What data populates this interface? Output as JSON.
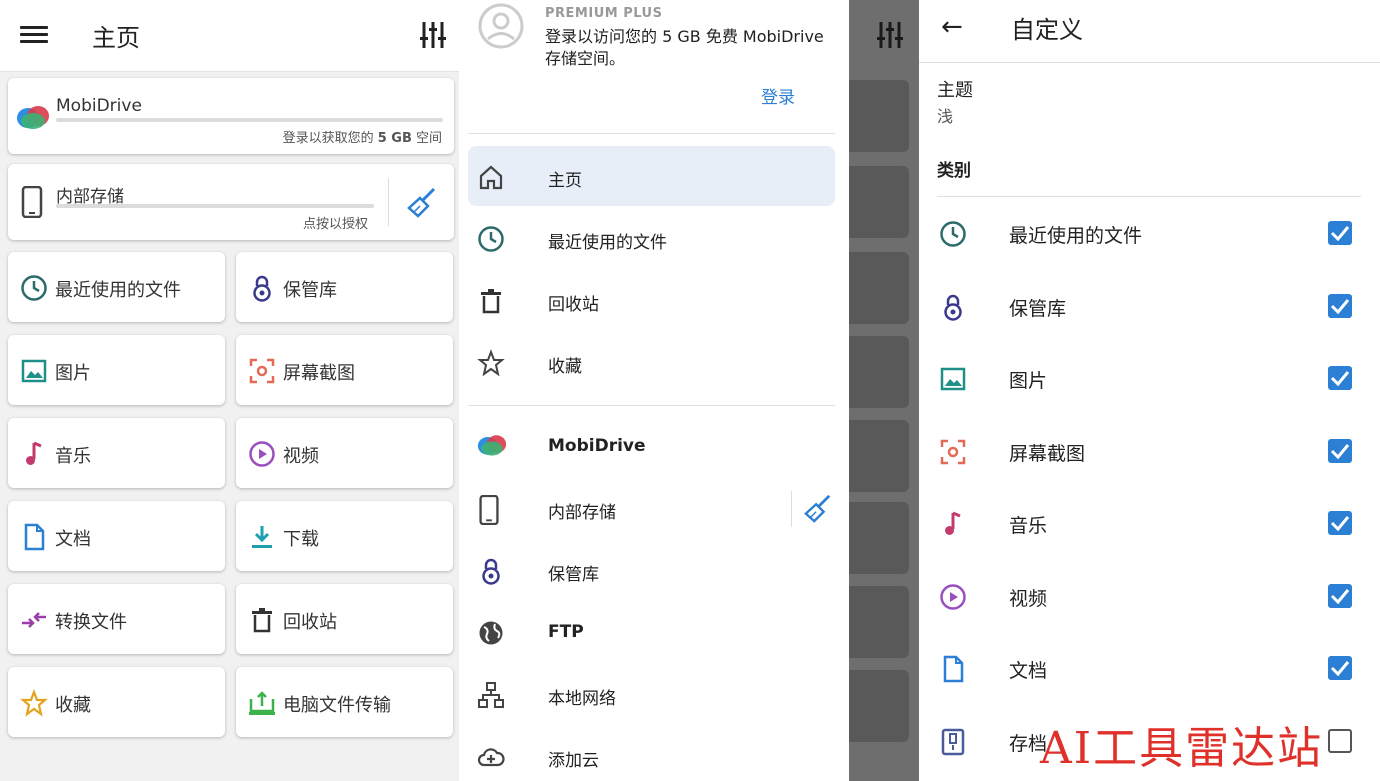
{
  "home": {
    "title": "主页",
    "mobidrive": {
      "name": "MobiDrive",
      "subtitle_prefix": "登录以获取您的 ",
      "subtitle_bold": "5 GB",
      "subtitle_suffix": " 空间"
    },
    "internal": {
      "name": "内部存储",
      "subtitle": "点按以授权"
    },
    "tiles": [
      {
        "label": "最近使用的文件",
        "icon": "clock-icon"
      },
      {
        "label": "保管库",
        "icon": "vault-lock-icon"
      },
      {
        "label": "图片",
        "icon": "image-icon"
      },
      {
        "label": "屏幕截图",
        "icon": "screenshot-icon"
      },
      {
        "label": "音乐",
        "icon": "music-note-icon"
      },
      {
        "label": "视频",
        "icon": "play-circle-icon"
      },
      {
        "label": "文档",
        "icon": "document-icon"
      },
      {
        "label": "下载",
        "icon": "download-icon"
      },
      {
        "label": "转换文件",
        "icon": "convert-arrows-icon"
      },
      {
        "label": "回收站",
        "icon": "trash-icon"
      },
      {
        "label": "收藏",
        "icon": "star-icon"
      },
      {
        "label": "电脑文件传输",
        "icon": "pc-transfer-icon"
      }
    ]
  },
  "drawer": {
    "premium": "PREMIUM PLUS",
    "message": "登录以访问您的 5 GB 免费 MobiDrive 存储空间。",
    "login": "登录",
    "items": [
      {
        "label": "主页",
        "icon": "home-icon"
      },
      {
        "label": "最近使用的文件",
        "icon": "clock-icon"
      },
      {
        "label": "回收站",
        "icon": "trash-icon"
      },
      {
        "label": "收藏",
        "icon": "star-outline-icon"
      },
      {
        "label": "MobiDrive",
        "icon": "mobidrive-logo-icon"
      },
      {
        "label": "内部存储",
        "icon": "phone-icon"
      },
      {
        "label": "保管库",
        "icon": "vault-lock-icon"
      },
      {
        "label": "FTP",
        "icon": "globe-icon"
      },
      {
        "label": "本地网络",
        "icon": "network-icon"
      },
      {
        "label": "添加云",
        "icon": "cloud-add-icon"
      }
    ]
  },
  "customize": {
    "title": "自定义",
    "theme_label": "主题",
    "theme_value": "浅",
    "category_header": "类别",
    "categories": [
      {
        "label": "最近使用的文件",
        "checked": true,
        "icon": "clock-icon"
      },
      {
        "label": "保管库",
        "checked": true,
        "icon": "vault-lock-icon"
      },
      {
        "label": "图片",
        "checked": true,
        "icon": "image-icon"
      },
      {
        "label": "屏幕截图",
        "checked": true,
        "icon": "screenshot-icon"
      },
      {
        "label": "音乐",
        "checked": true,
        "icon": "music-note-icon"
      },
      {
        "label": "视频",
        "checked": true,
        "icon": "play-circle-icon"
      },
      {
        "label": "文档",
        "checked": true,
        "icon": "document-icon"
      },
      {
        "label": "存档",
        "checked": false,
        "icon": "archive-icon"
      }
    ]
  },
  "watermark": {
    "text": "AI工具雷达站"
  },
  "colors": {
    "accent": "#2b7fd4",
    "selected_bg": "#e8eef8"
  }
}
